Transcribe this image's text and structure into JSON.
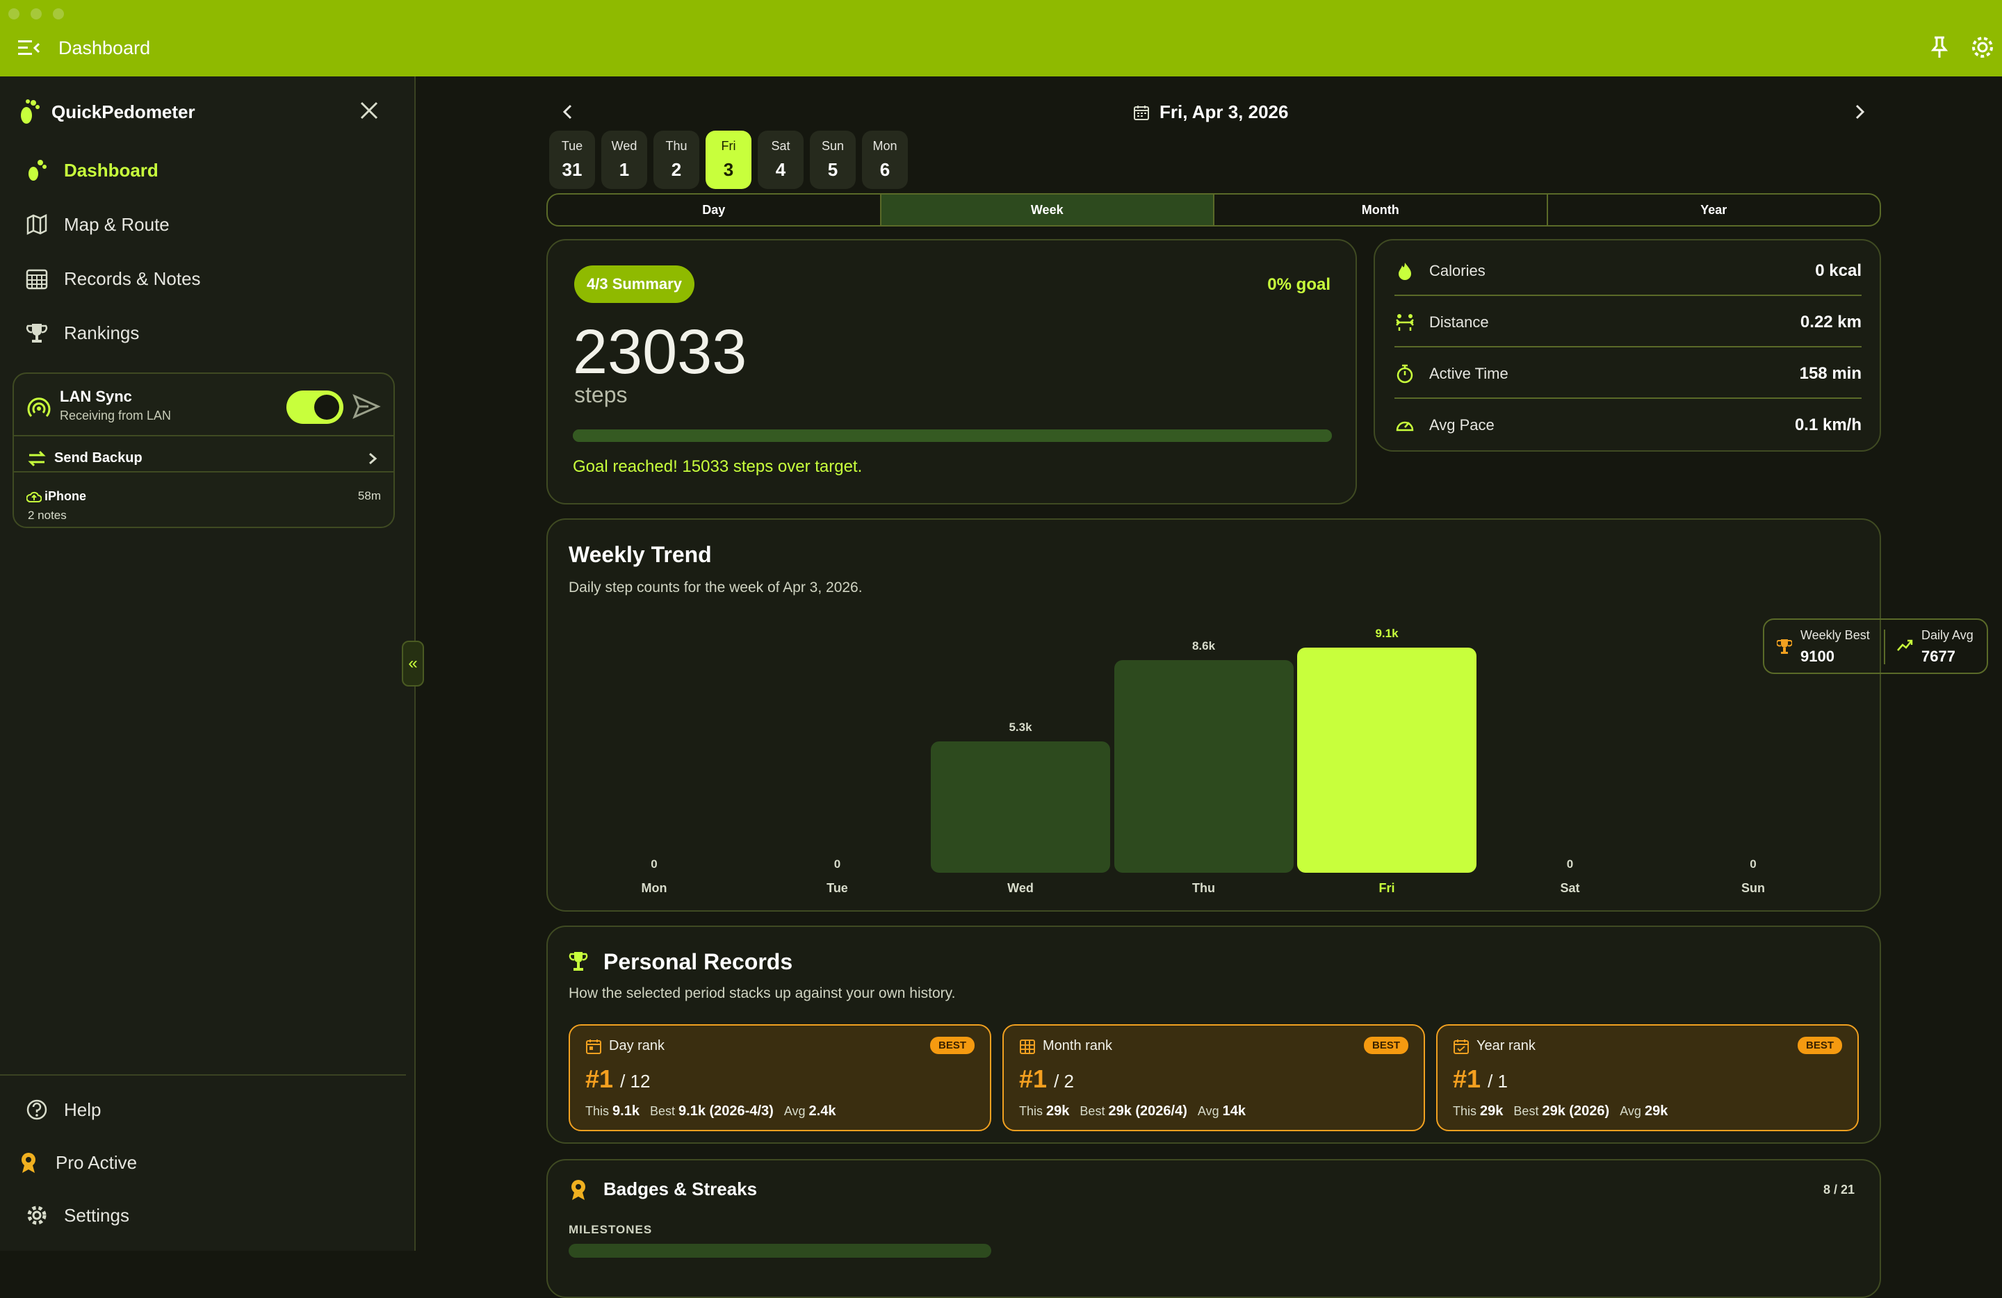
{
  "app": {
    "window_title": "Dashboard",
    "brand": "QuickPedometer"
  },
  "nav": {
    "items": [
      "Dashboard",
      "Map & Route",
      "Records & Notes",
      "Rankings"
    ],
    "bottom": [
      "Help",
      "Pro Active",
      "Settings"
    ]
  },
  "lan": {
    "title": "LAN Sync",
    "subtitle": "Receiving from LAN",
    "enabled": true,
    "send_backup": "Send Backup",
    "device": "iPhone",
    "device_notes": "2 notes",
    "device_time": "58m"
  },
  "date": {
    "current": "Fri, Apr 3, 2026"
  },
  "days": [
    {
      "name": "Tue",
      "num": "31"
    },
    {
      "name": "Wed",
      "num": "1"
    },
    {
      "name": "Thu",
      "num": "2"
    },
    {
      "name": "Fri",
      "num": "3",
      "selected": true
    },
    {
      "name": "Sat",
      "num": "4"
    },
    {
      "name": "Sun",
      "num": "5"
    },
    {
      "name": "Mon",
      "num": "6"
    }
  ],
  "periods": [
    "Day",
    "Week",
    "Month",
    "Year"
  ],
  "selected_period": "Week",
  "summary": {
    "badge": "4/3 Summary",
    "goal_pct": "0% goal",
    "steps": "23033",
    "steps_label": "steps",
    "message": "Goal reached! 15033 steps over target.",
    "progress": 1.0
  },
  "stats": [
    {
      "label": "Calories",
      "value": "0 kcal",
      "icon": "flame-icon"
    },
    {
      "label": "Distance",
      "value": "0.22 km",
      "icon": "distance-icon"
    },
    {
      "label": "Active Time",
      "value": "158 min",
      "icon": "stopwatch-icon"
    },
    {
      "label": "Avg Pace",
      "value": "0.1 km/h",
      "icon": "speedometer-icon"
    }
  ],
  "weekly": {
    "title": "Weekly Trend",
    "subtitle": "Daily step counts for the week of Apr 3, 2026.",
    "best_label": "Weekly Best",
    "best_value": "9100",
    "avg_label": "Daily Avg",
    "avg_value": "7677"
  },
  "chart_data": {
    "type": "bar",
    "categories": [
      "Mon",
      "Tue",
      "Wed",
      "Thu",
      "Fri",
      "Sat",
      "Sun"
    ],
    "values": [
      0,
      0,
      5300,
      8600,
      9100,
      0,
      0
    ],
    "labels": [
      "0",
      "0",
      "5.3k",
      "8.6k",
      "9.1k",
      "0",
      "0"
    ],
    "highlight": "Fri",
    "colors": {
      "normal": "#2d4a1e",
      "highlight": "#c8ff3c"
    }
  },
  "records": {
    "title": "Personal Records",
    "subtitle": "How the selected period stacks up against your own history.",
    "cards": [
      {
        "title": "Day rank",
        "badge": "BEST",
        "rank": "#1",
        "total": "/ 12",
        "this_label": "This",
        "this_value": "9.1k",
        "best_label": "Best",
        "best_value": "9.1k (2026-4/3)",
        "avg_label": "Avg",
        "avg_value": "2.4k"
      },
      {
        "title": "Month rank",
        "badge": "BEST",
        "rank": "#1",
        "total": "/ 2",
        "this_label": "This",
        "this_value": "29k",
        "best_label": "Best",
        "best_value": "29k (2026/4)",
        "avg_label": "Avg",
        "avg_value": "14k"
      },
      {
        "title": "Year rank",
        "badge": "BEST",
        "rank": "#1",
        "total": "/ 1",
        "this_label": "This",
        "this_value": "29k",
        "best_label": "Best",
        "best_value": "29k (2026)",
        "avg_label": "Avg",
        "avg_value": "29k"
      }
    ]
  },
  "badges": {
    "title": "Badges & Streaks",
    "count": "8 / 21",
    "section": "MILESTONES"
  },
  "colors": {
    "accent": "#c8ff3c",
    "titlebar": "#8fba00",
    "rank": "#f5a020"
  }
}
